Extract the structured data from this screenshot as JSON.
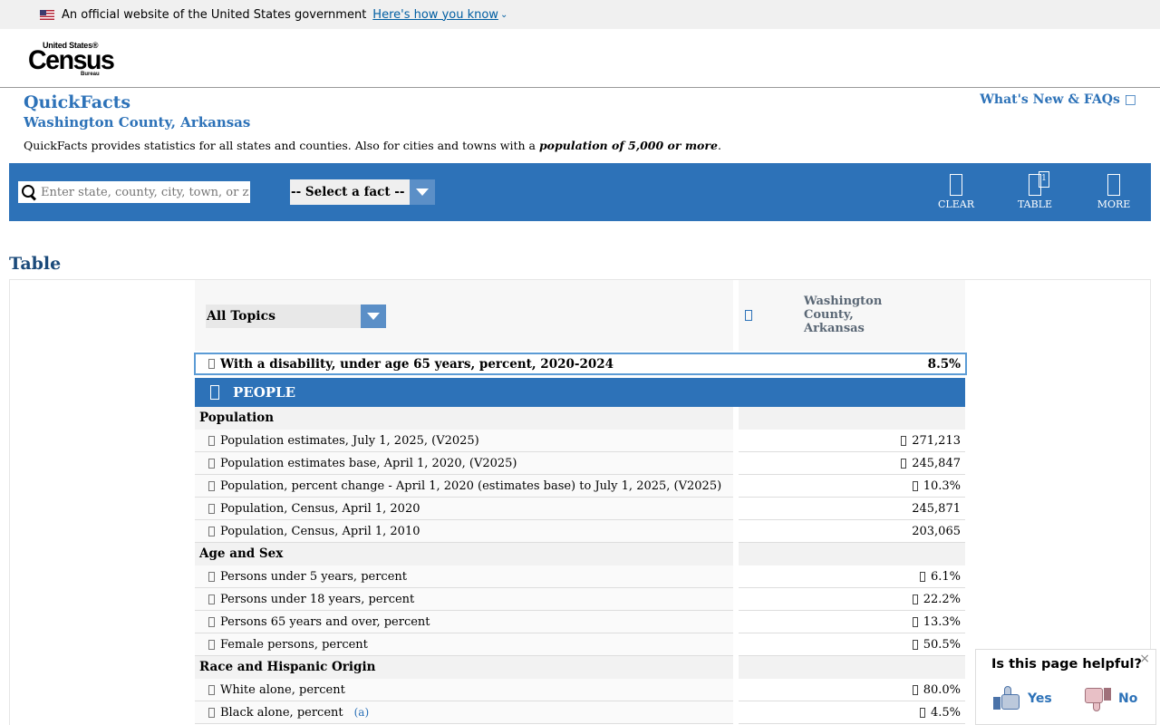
{
  "gov_banner": {
    "text": "An official website of the United States government",
    "link": "Here's how you know"
  },
  "logo": {
    "line1": "United States®",
    "line2": "Census",
    "line3": "Bureau"
  },
  "page": {
    "title": "QuickFacts",
    "subtitle": "Washington County, Arkansas",
    "whats_new": "What's New & FAQs □",
    "intro_text": "QuickFacts provides statistics for all states and counties. Also for cities and towns with a ",
    "intro_em": "population of 5,000 or more",
    "intro_end": "."
  },
  "toolbar": {
    "search_placeholder": "Enter state, county, city, town, or zip code",
    "fact_select": "-- Select a fact --",
    "clear_label": "CLEAR",
    "table_label": "TABLE",
    "table_badge": "1",
    "more_label": "MORE"
  },
  "table": {
    "heading": "Table",
    "topics_select": "All Topics",
    "geo_column": "Washington County, Arkansas",
    "selected_fact": {
      "label": "With a disability, under age 65 years, percent, 2020-2024",
      "value": "8.5%"
    },
    "section": "PEOPLE",
    "groups": [
      {
        "name": "Population",
        "rows": [
          {
            "label": "Population estimates, July 1, 2025, (V2025)",
            "value": "271,213",
            "flag": true
          },
          {
            "label": "Population estimates base, April 1, 2020, (V2025)",
            "value": "245,847",
            "flag": true
          },
          {
            "label": "Population, percent change - April 1, 2020 (estimates base) to July 1, 2025, (V2025)",
            "value": "10.3%",
            "flag": true
          },
          {
            "label": "Population, Census, April 1, 2020",
            "value": "245,871",
            "flag": false
          },
          {
            "label": "Population, Census, April 1, 2010",
            "value": "203,065",
            "flag": false
          }
        ]
      },
      {
        "name": "Age and Sex",
        "rows": [
          {
            "label": "Persons under 5 years, percent",
            "value": "6.1%",
            "flag": true
          },
          {
            "label": "Persons under 18 years, percent",
            "value": "22.2%",
            "flag": true
          },
          {
            "label": "Persons 65 years and over, percent",
            "value": "13.3%",
            "flag": true
          },
          {
            "label": "Female persons, percent",
            "value": "50.5%",
            "flag": true
          }
        ]
      },
      {
        "name": "Race and Hispanic Origin",
        "rows": [
          {
            "label": "White alone, percent",
            "value": "80.0%",
            "flag": true
          },
          {
            "label": "Black alone, percent",
            "value": "4.5%",
            "flag": true,
            "footnote": "(a)"
          }
        ]
      }
    ]
  },
  "feedback": {
    "question": "Is this page helpful?",
    "yes": "Yes",
    "no": "No",
    "close": "×"
  }
}
